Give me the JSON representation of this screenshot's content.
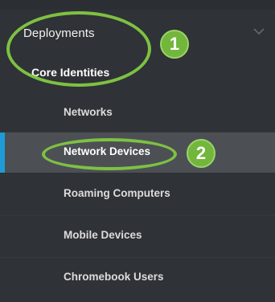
{
  "sidebar": {
    "section": {
      "label": "Deployments",
      "icon": "chevron-down-icon"
    },
    "subsection": {
      "label": "Core Identities"
    },
    "items": [
      {
        "label": "Networks",
        "active": false
      },
      {
        "label": "Network Devices",
        "active": true
      },
      {
        "label": "Roaming Computers",
        "active": false
      },
      {
        "label": "Mobile Devices",
        "active": false
      },
      {
        "label": "Chromebook Users",
        "active": false
      }
    ]
  },
  "annotations": {
    "badge1": "1",
    "badge2": "2",
    "color": "#7ec142"
  },
  "colors": {
    "background": "#2f3236",
    "active_item": "#4c5055",
    "accent": "#1e9bd7"
  }
}
